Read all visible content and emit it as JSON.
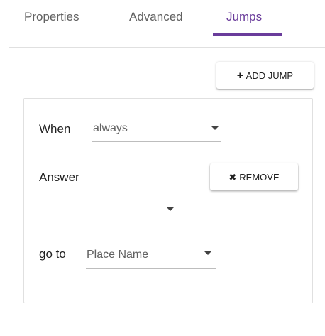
{
  "tabs": [
    {
      "label": "Properties",
      "active": false
    },
    {
      "label": "Advanced",
      "active": false
    },
    {
      "label": "Jumps",
      "active": true
    }
  ],
  "colors": {
    "accent": "#6a3c9b",
    "border": "#e0e0e0",
    "text": "#212121",
    "muted_text": "#616161"
  },
  "toolbar": {
    "add_jump_label": "ADD JUMP",
    "add_jump_icon": "plus-icon"
  },
  "jump": {
    "when_label": "When",
    "when_value": "always",
    "answer_label": "Answer",
    "answer_value": "",
    "remove_label": "REMOVE",
    "remove_icon": "close-icon",
    "goto_label": "go to",
    "goto_value": "Place Name"
  }
}
